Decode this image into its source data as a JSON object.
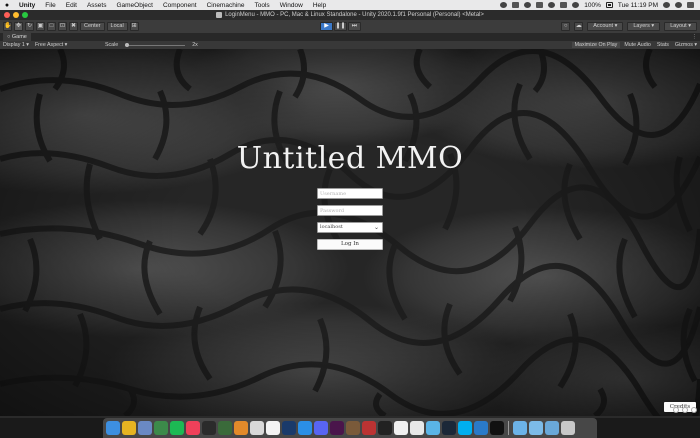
{
  "menubar": {
    "app": "Unity",
    "items": [
      "File",
      "Edit",
      "Assets",
      "GameObject",
      "Component",
      "Cinemachine",
      "Tools",
      "Window",
      "Help"
    ],
    "battery": "100%",
    "clock": "Tue 11:19 PM"
  },
  "window": {
    "title": "LoginMenu - MMO - PC, Mac & Linux Standalone - Unity 2020.1.9f1 Personal (Personal) <Metal>"
  },
  "toolbar": {
    "pivot_label": "Center",
    "space_label": "Local",
    "account_label": "Account",
    "layers_label": "Layers",
    "layout_label": "Layout"
  },
  "game_view": {
    "tab_label": "Game",
    "display_label": "Display 1",
    "aspect_label": "Free Aspect",
    "scale_label": "Scale",
    "scale_value": "2x",
    "maximize_label": "Maximize On Play",
    "mute_label": "Mute Audio",
    "stats_label": "Stats",
    "gizmos_label": "Gizmos"
  },
  "login": {
    "title": "Untitled MMO",
    "username_placeholder": "Username",
    "password_placeholder": "Password",
    "server_value": "localhost",
    "login_label": "Log In",
    "credits_label": "Credits"
  },
  "colors": {
    "play_active": "#3b79c9",
    "editor_bg": "#3c3c3c"
  },
  "dock": {
    "icons": [
      {
        "name": "finder-icon",
        "color": "#3d8fe0"
      },
      {
        "name": "chrome-icon",
        "color": "#e6b422"
      },
      {
        "name": "preview-icon",
        "color": "#6a89c4"
      },
      {
        "name": "android-studio-icon",
        "color": "#3c8a4a"
      },
      {
        "name": "spotify-icon",
        "color": "#1db954"
      },
      {
        "name": "music-icon",
        "color": "#f0405a"
      },
      {
        "name": "terminal-icon",
        "color": "#2b2b2b"
      },
      {
        "name": "app-icon-1",
        "color": "#3a6a3a"
      },
      {
        "name": "sublime-icon",
        "color": "#e28a2a"
      },
      {
        "name": "books-icon",
        "color": "#d8d8d8"
      },
      {
        "name": "calendar-icon",
        "color": "#f3f3f3"
      },
      {
        "name": "photoshop-icon",
        "color": "#1a3a6a"
      },
      {
        "name": "app-store-icon",
        "color": "#2b8fe6"
      },
      {
        "name": "discord-icon",
        "color": "#5865f2"
      },
      {
        "name": "slack-icon",
        "color": "#4a154b"
      },
      {
        "name": "minecraft-icon",
        "color": "#7a5a3a"
      },
      {
        "name": "app-icon-2",
        "color": "#b33"
      },
      {
        "name": "pycharm-icon",
        "color": "#222"
      },
      {
        "name": "typora-icon",
        "color": "#f0f0f0"
      },
      {
        "name": "notes-icon",
        "color": "#e8e8e8"
      },
      {
        "name": "app-icon-3",
        "color": "#5ab4e6"
      },
      {
        "name": "steam-icon",
        "color": "#1b2838"
      },
      {
        "name": "skype-icon",
        "color": "#00aff0"
      },
      {
        "name": "vscode-icon",
        "color": "#2a7ac8"
      },
      {
        "name": "unity-icon",
        "color": "#111"
      },
      {
        "name": "folder-icon",
        "color": "#6cb3e8"
      },
      {
        "name": "home-folder-icon",
        "color": "#7cbbe8"
      },
      {
        "name": "downloads-folder-icon",
        "color": "#6aa8d8"
      },
      {
        "name": "trash-icon",
        "color": "#c8c8c8"
      }
    ]
  }
}
